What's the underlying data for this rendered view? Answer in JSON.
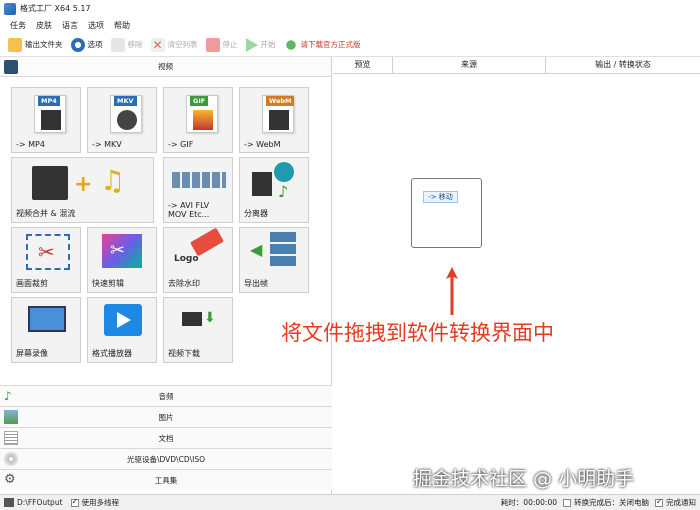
{
  "window": {
    "title": "格式工厂 X64 5.17"
  },
  "menu": [
    "任务",
    "皮肤",
    "语言",
    "选项",
    "帮助"
  ],
  "toolbar": {
    "output_folder": "输出文件夹",
    "options": "选项",
    "remove": "移除",
    "clear_list": "清空列表",
    "stop": "停止",
    "start": "开始",
    "download_link": "请下载官方正式版"
  },
  "left": {
    "video_section": "视频",
    "tiles": [
      {
        "fmt": "MP4",
        "label": "-> MP4",
        "color": "#2a6db5"
      },
      {
        "fmt": "MKV",
        "label": "-> MKV",
        "color": "#2a6db5"
      },
      {
        "fmt": "GIF",
        "label": "-> GIF",
        "color": "#3b9a3b"
      },
      {
        "fmt": "WebM",
        "label": "-> WebM",
        "color": "#d47a22"
      },
      {
        "label": "视频合并 & 混流"
      },
      {
        "label_line1": "-> AVI FLV",
        "label": "MOV Etc..."
      },
      {
        "label": "分离器"
      },
      {
        "label": "画面裁剪"
      },
      {
        "label": "快速剪辑"
      },
      {
        "label": "去除水印"
      },
      {
        "label": "导出帧"
      },
      {
        "label": "屏幕录像"
      },
      {
        "label": "格式播放器"
      },
      {
        "label": "视频下载"
      }
    ],
    "sections": [
      "音频",
      "图片",
      "文档",
      "光驱设备\\DVD\\CD\\ISO",
      "工具集"
    ]
  },
  "right": {
    "columns": [
      "预览",
      "来源",
      "输出 / 转换状态"
    ],
    "move_label": "-> 移动",
    "hint": "将文件拖拽到软件转换界面中",
    "watermark": "掘金技术社区 @ 小明助手"
  },
  "status": {
    "path": "D:\\FFOutput",
    "multithread": "使用多线程",
    "elapsed": "耗时：00:00:00",
    "after_convert": "转换完成后：关闭电脑",
    "notify": "完成通知"
  },
  "colors": {
    "accent": "#2a6db5",
    "hint": "#e53b1f"
  }
}
